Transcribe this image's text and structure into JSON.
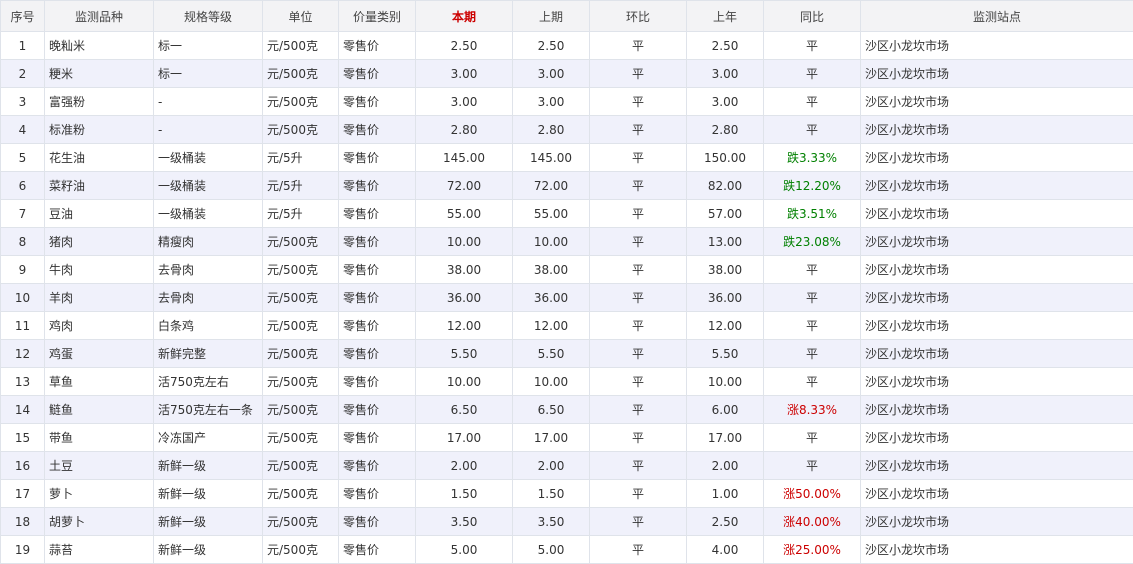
{
  "headers": [
    "序号",
    "监测品种",
    "规格等级",
    "单位",
    "价量类别",
    "本期",
    "上期",
    "环比",
    "上年",
    "同比",
    "监测站点"
  ],
  "rows": [
    [
      "1",
      "晚籼米",
      "标一",
      "元/500克",
      "零售价",
      "2.50",
      "2.50",
      "平",
      "2.50",
      "平",
      "沙区小龙坎市场"
    ],
    [
      "2",
      "粳米",
      "标一",
      "元/500克",
      "零售价",
      "3.00",
      "3.00",
      "平",
      "3.00",
      "平",
      "沙区小龙坎市场"
    ],
    [
      "3",
      "富强粉",
      "-",
      "元/500克",
      "零售价",
      "3.00",
      "3.00",
      "平",
      "3.00",
      "平",
      "沙区小龙坎市场"
    ],
    [
      "4",
      "标准粉",
      "-",
      "元/500克",
      "零售价",
      "2.80",
      "2.80",
      "平",
      "2.80",
      "平",
      "沙区小龙坎市场"
    ],
    [
      "5",
      "花生油",
      "一级桶装",
      "元/5升",
      "零售价",
      "145.00",
      "145.00",
      "平",
      "150.00",
      "跌3.33%",
      "沙区小龙坎市场"
    ],
    [
      "6",
      "菜籽油",
      "一级桶装",
      "元/5升",
      "零售价",
      "72.00",
      "72.00",
      "平",
      "82.00",
      "跌12.20%",
      "沙区小龙坎市场"
    ],
    [
      "7",
      "豆油",
      "一级桶装",
      "元/5升",
      "零售价",
      "55.00",
      "55.00",
      "平",
      "57.00",
      "跌3.51%",
      "沙区小龙坎市场"
    ],
    [
      "8",
      "猪肉",
      "精瘦肉",
      "元/500克",
      "零售价",
      "10.00",
      "10.00",
      "平",
      "13.00",
      "跌23.08%",
      "沙区小龙坎市场"
    ],
    [
      "9",
      "牛肉",
      "去骨肉",
      "元/500克",
      "零售价",
      "38.00",
      "38.00",
      "平",
      "38.00",
      "平",
      "沙区小龙坎市场"
    ],
    [
      "10",
      "羊肉",
      "去骨肉",
      "元/500克",
      "零售价",
      "36.00",
      "36.00",
      "平",
      "36.00",
      "平",
      "沙区小龙坎市场"
    ],
    [
      "11",
      "鸡肉",
      "白条鸡",
      "元/500克",
      "零售价",
      "12.00",
      "12.00",
      "平",
      "12.00",
      "平",
      "沙区小龙坎市场"
    ],
    [
      "12",
      "鸡蛋",
      "新鲜完整",
      "元/500克",
      "零售价",
      "5.50",
      "5.50",
      "平",
      "5.50",
      "平",
      "沙区小龙坎市场"
    ],
    [
      "13",
      "草鱼",
      "活750克左右",
      "元/500克",
      "零售价",
      "10.00",
      "10.00",
      "平",
      "10.00",
      "平",
      "沙区小龙坎市场"
    ],
    [
      "14",
      "鲢鱼",
      "活750克左右一条",
      "元/500克",
      "零售价",
      "6.50",
      "6.50",
      "平",
      "6.00",
      "涨8.33%",
      "沙区小龙坎市场"
    ],
    [
      "15",
      "带鱼",
      "冷冻国产",
      "元/500克",
      "零售价",
      "17.00",
      "17.00",
      "平",
      "17.00",
      "平",
      "沙区小龙坎市场"
    ],
    [
      "16",
      "土豆",
      "新鲜一级",
      "元/500克",
      "零售价",
      "2.00",
      "2.00",
      "平",
      "2.00",
      "平",
      "沙区小龙坎市场"
    ],
    [
      "17",
      "萝卜",
      "新鲜一级",
      "元/500克",
      "零售价",
      "1.50",
      "1.50",
      "平",
      "1.00",
      "涨50.00%",
      "沙区小龙坎市场"
    ],
    [
      "18",
      "胡萝卜",
      "新鲜一级",
      "元/500克",
      "零售价",
      "3.50",
      "3.50",
      "平",
      "2.50",
      "涨40.00%",
      "沙区小龙坎市场"
    ],
    [
      "19",
      "蒜苔",
      "新鲜一级",
      "元/500克",
      "零售价",
      "5.00",
      "5.00",
      "平",
      "4.00",
      "涨25.00%",
      "沙区小龙坎市场"
    ]
  ],
  "colors": {
    "up": "#cc0000",
    "down": "#008000",
    "current_header": "#cc0000",
    "header_bg": "#f3f3f5",
    "stripe_bg": "#f0f1fb"
  }
}
